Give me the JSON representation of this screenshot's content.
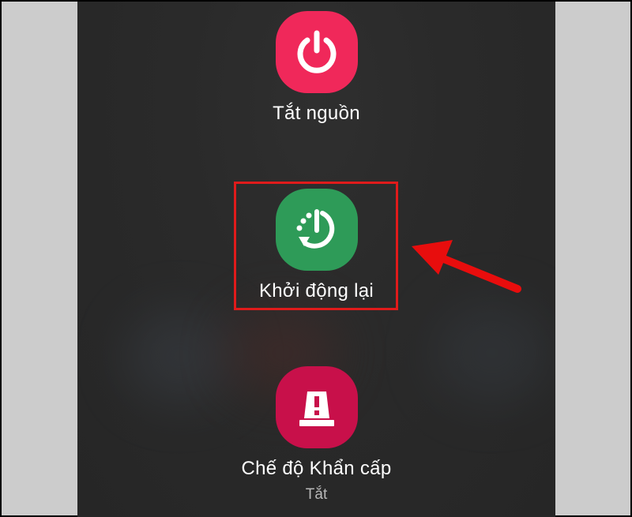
{
  "power_menu": {
    "options": [
      {
        "label": "Tắt nguồn",
        "icon": "power-icon",
        "color": "#f0285a"
      },
      {
        "label": "Khởi động lại",
        "icon": "restart-icon",
        "color": "#2e9b58"
      },
      {
        "label": "Chế độ Khẩn cấp",
        "sublabel": "Tắt",
        "icon": "emergency-light-icon",
        "color": "#c8104a"
      }
    ]
  },
  "annotation": {
    "highlight_color": "#e01b1b",
    "arrow_icon": "red-arrow-icon"
  }
}
